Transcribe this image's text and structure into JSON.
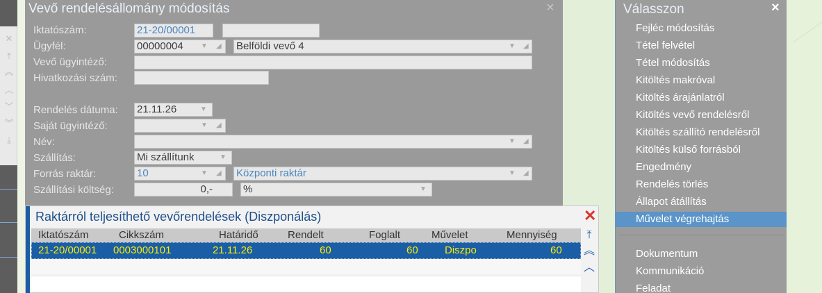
{
  "dialog": {
    "title": "Vevő rendelésállomány módosítás",
    "close_icon": "×",
    "fields": {
      "iktatoszam": {
        "label": "Iktatószám:",
        "value": "21-20/00001"
      },
      "ugyfel": {
        "label": "Ügyfél:",
        "code": "00000004",
        "name": "Belföldi vevő 4"
      },
      "vevo_ugyintezo": {
        "label": "Vevő ügyintéző:",
        "value": ""
      },
      "hivatkozasi_szam": {
        "label": "Hivatkozási szám:",
        "value": ""
      },
      "rendeles_datuma": {
        "label": "Rendelés dátuma:",
        "value": "21.11.26"
      },
      "sajat_ugyintezo": {
        "label": "Saját ügyintéző:",
        "value": ""
      },
      "nev": {
        "label": "Név:",
        "value": ""
      },
      "szallitas": {
        "label": "Szállítás:",
        "value": "Mi szállítunk"
      },
      "forras_raktar": {
        "label": "Forrás raktár:",
        "code": "10",
        "name": "Központi raktár"
      },
      "szallitasi_koltseg": {
        "label": "Szállítási költség:",
        "value": "0,-",
        "unit": "%"
      }
    }
  },
  "subdialog": {
    "title": "Raktárról teljesíthető vevőrendelések (Diszponálás)",
    "close_icon": "✕",
    "columns": [
      "Iktatószám",
      "Cikkszám",
      "Határidő",
      "Rendelt",
      "Foglalt",
      "Művelet",
      "Mennyiség"
    ],
    "rows": [
      [
        "21-20/00001",
        "0003000101",
        "21.11.26",
        "60",
        "60",
        "Diszpo",
        "60"
      ]
    ]
  },
  "menu": {
    "title": "Válasszon",
    "close_icon": "×",
    "items": [
      "Fejléc módosítás",
      "Tétel felvétel",
      "Tétel módosítás",
      "Kitöltés makróval",
      "Kitöltés árajánlatról",
      "Kitöltés vevő rendelésről",
      "Kitöltés szállító rendelésről",
      "Kitöltés külső forrásból",
      "Engedmény",
      "Rendelés törlés",
      "Állapot átállítás",
      "Művelet végrehajtás"
    ],
    "selected_index": 11,
    "items2": [
      "Dokumentum",
      "Kommunikáció",
      "Feladat"
    ]
  },
  "colors": {
    "selection": "#5b94c9",
    "row_selected": "#1a5ea6",
    "row_text": "#ffea00"
  }
}
